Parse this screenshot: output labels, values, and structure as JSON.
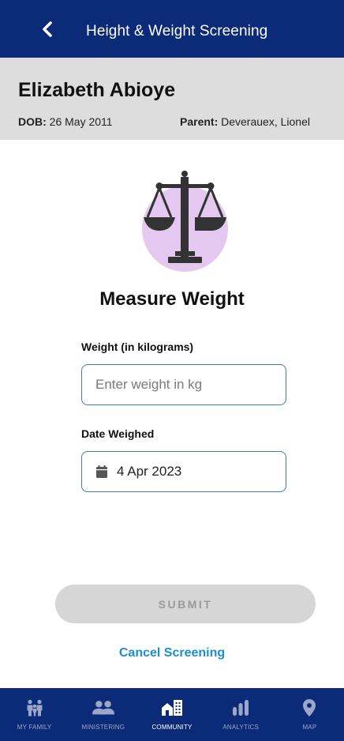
{
  "header": {
    "title": "Height & Weight Screening",
    "back_icon": "chevron-left-icon"
  },
  "patient": {
    "name": "Elizabeth Abioye",
    "dob_label": "DOB:",
    "dob_value": " 26 May 2011",
    "parent_label": "Parent:",
    "parent_value": " Deverauex, Lionel"
  },
  "main": {
    "icon": "scale-icon",
    "heading": "Measure Weight",
    "weight_label": "Weight (in kilograms)",
    "weight_placeholder": "Enter weight in kg",
    "weight_value": "",
    "date_label": "Date Weighed",
    "date_value": "4 Apr 2023",
    "date_icon": "calendar-icon",
    "submit_label": "SUBMIT",
    "cancel_label": "Cancel Screening"
  },
  "colors": {
    "brand": "#0b2b79",
    "link": "#1a8fd0",
    "icon_circle": "#e4c8ef"
  },
  "bottom_nav": {
    "items": [
      {
        "label": "MY FAMILY",
        "icon": "family-icon",
        "active": false
      },
      {
        "label": "MINISTERING",
        "icon": "people-icon",
        "active": false
      },
      {
        "label": "COMMUNITY",
        "icon": "community-icon",
        "active": true
      },
      {
        "label": "ANALYTICS",
        "icon": "bar-chart-icon",
        "active": false
      },
      {
        "label": "MAP",
        "icon": "map-pin-icon",
        "active": false
      }
    ]
  }
}
